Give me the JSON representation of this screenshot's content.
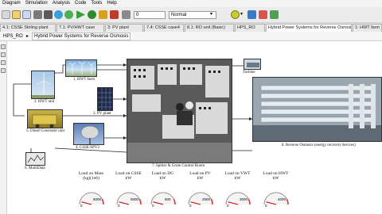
{
  "menubar": {
    "items": [
      "Diagram",
      "Simulation",
      "Analysis",
      "Code",
      "Tools",
      "Help"
    ]
  },
  "toolbar": {
    "speed_value": "0",
    "mode_value": "Normal",
    "mode_options": [
      "Normal"
    ]
  },
  "tabs": [
    {
      "label": "4.1: CSSE Stirling plant"
    },
    {
      "label": "7.1: PV/HWT case"
    },
    {
      "label": "3: PV plant"
    },
    {
      "label": "7.4: CSSE case4"
    },
    {
      "label": "8.1: RO unit (Basic)"
    },
    {
      "label": "HPS_RO"
    },
    {
      "label": "Hybrid Power Systems for Reverse Osmosis"
    },
    {
      "label": "1: HWT farm"
    }
  ],
  "breadcrumb": {
    "root": "HPS_RO",
    "current": "Hybrid Power Systems for Reverse Osmosis"
  },
  "blocks": {
    "hwt_farm": "1. HWT farm",
    "hwt_unit": "2. HWT unit",
    "pv_plant": "3. PV plant",
    "diesel": "5. Diesel Generator unit",
    "csse": "4. CSSE/SPV2",
    "scope": "6. MultiData",
    "spliter": "7. Spliter & Grote Control Room",
    "ro": "8. Reverse Osmosis (energy recovery devices)",
    "pelton": "Turbine"
  },
  "gauges": [
    {
      "label": "Load on Mass",
      "unit": "(kg)(1e6)",
      "max": "5000",
      "min": "0",
      "value": 0.08
    },
    {
      "label": "Load on CSSE",
      "unit": "kW",
      "max": "5000",
      "min": "0",
      "value": 0.08
    },
    {
      "label": "Load on DG",
      "unit": "kW",
      "max": "500",
      "min": "0",
      "value": 0.08
    },
    {
      "label": "Load on PV",
      "unit": "kW",
      "max": "2500",
      "min": "0",
      "value": 0.08
    },
    {
      "label": "Load on VWT",
      "unit": "kW",
      "max": "3000",
      "min": "0",
      "value": 0.08
    },
    {
      "label": "Load on HWT",
      "unit": "kW",
      "max": "4000",
      "min": "0",
      "value": 0.08
    }
  ]
}
